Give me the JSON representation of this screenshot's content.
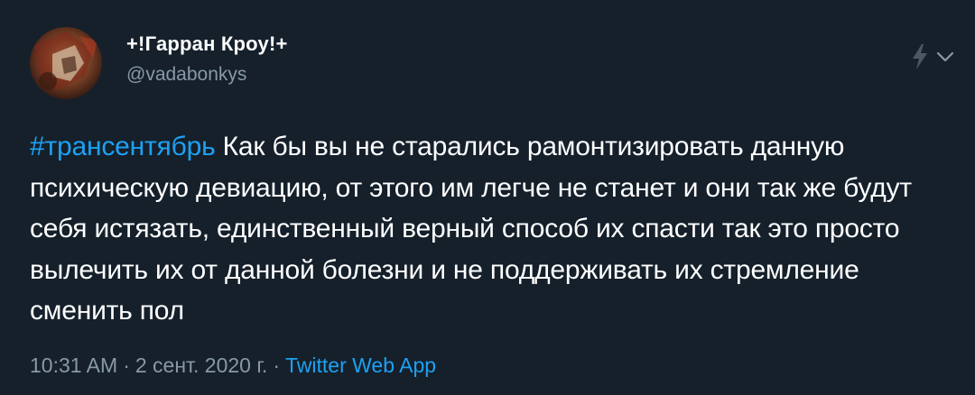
{
  "author": {
    "display_name": "+!Гарран Кроу!+",
    "handle": "@vadabonkys"
  },
  "tweet": {
    "hashtag": "#трансентябрь",
    "body": " Как бы вы не старались рамонтизировать данную психическую девиацию, от этого им легче не станет и они так же будут себя истязать, единственный верный способ их спасти так это просто вылечить их от данной болезни и не поддерживать их стремление сменить пол"
  },
  "meta": {
    "time": "10:31 AM",
    "separator": "·",
    "date": "2 сент. 2020 г.",
    "source": "Twitter Web App"
  },
  "icons": {
    "top_right": [
      "lightning-icon",
      "chevron-down-icon"
    ],
    "avatar": "avatar-image"
  },
  "colors": {
    "background": "#15202b",
    "text": "#ffffff",
    "secondary": "#8899a6",
    "link": "#1da1f2"
  }
}
